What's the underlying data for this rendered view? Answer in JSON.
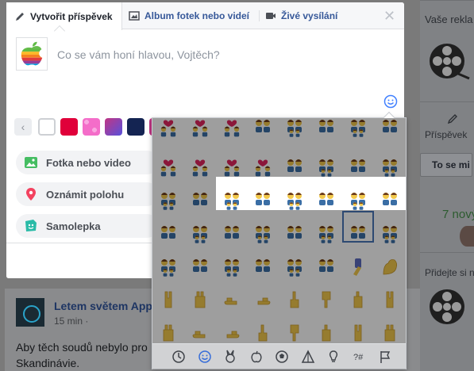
{
  "composer": {
    "tabs": [
      {
        "label": "Vytvořit příspěvek",
        "icon": "pencil-icon"
      },
      {
        "label": "Album fotek nebo videí",
        "icon": "photo-album-icon"
      },
      {
        "label": "Živé vysílání",
        "icon": "video-camera-icon"
      }
    ],
    "close_label": "✕",
    "placeholder": "Co se vám honí hlavou, Vojtěch?",
    "background_colors": [
      "#ebedf0",
      "#ffffff",
      "#e0003a",
      "#f46dc9",
      "#8a3ab9",
      "#142452",
      "#c13584"
    ],
    "actions": [
      {
        "label": "Fotka nebo video",
        "icon": "photo-icon",
        "color": "#45bd62"
      },
      {
        "label": "Oznámit polohu",
        "icon": "location-pin-icon",
        "color": "#f3425f"
      },
      {
        "label": "Samolepka",
        "icon": "sticker-icon",
        "color": "#2abba7"
      }
    ]
  },
  "emoji_picker": {
    "categories": [
      "recent-icon",
      "smiley-icon",
      "animal-icon",
      "food-icon",
      "ball-icon",
      "travel-icon",
      "lightbulb-icon",
      "symbols-icon",
      "flag-icon"
    ],
    "active_category": "smiley-icon"
  },
  "post": {
    "author": "Letem světem App",
    "time": "15 min ·",
    "text": "Aby těch soudů nebylo pro Skandinávie."
  },
  "right_column": {
    "ads_header": "Vaše rekla",
    "post_label": "Příspěvek",
    "button_label": "To se mi",
    "new_label": "7 nový",
    "follow_label": "Přidejte si n"
  }
}
